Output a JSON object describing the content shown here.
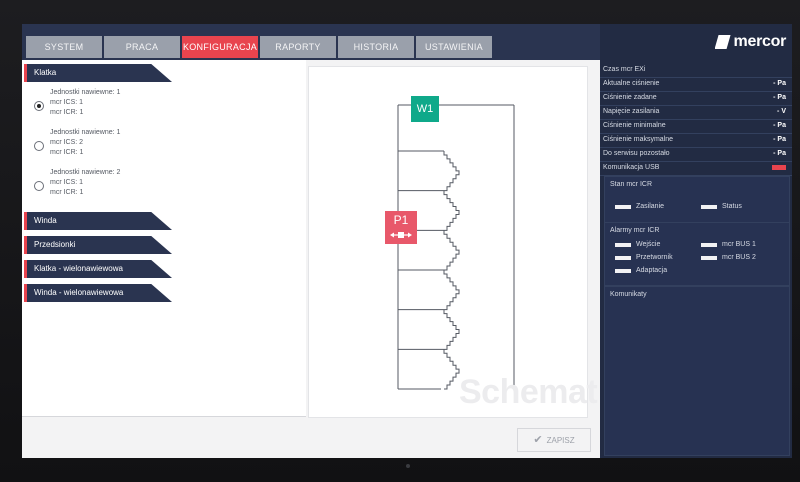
{
  "tabs": [
    {
      "label": "SYSTEM",
      "active": false
    },
    {
      "label": "PRACA",
      "active": false
    },
    {
      "label": "KONFIGURACJA",
      "active": true
    },
    {
      "label": "RAPORTY",
      "active": false
    },
    {
      "label": "HISTORIA",
      "active": false
    },
    {
      "label": "USTAWIENIA",
      "active": false
    }
  ],
  "sections": {
    "klatka": {
      "label": "Klatka",
      "options": [
        {
          "line1": "Jednostki nawiewne: 1",
          "line2": "mcr ICS: 1",
          "line3": "mcr ICR: 1",
          "selected": true
        },
        {
          "line1": "Jednostki nawiewne: 1",
          "line2": "mcr ICS: 2",
          "line3": "mcr ICR: 1",
          "selected": false
        },
        {
          "line1": "Jednostki nawiewne: 2",
          "line2": "mcr ICS: 1",
          "line3": "mcr ICR: 1",
          "selected": false
        }
      ]
    },
    "winda": {
      "label": "Winda"
    },
    "przedsionki": {
      "label": "Przedsionki"
    },
    "klatka_wielo": {
      "label": "Klatka - wielonawiewowa"
    },
    "winda_wielo": {
      "label": "Winda - wielonawiewowa"
    }
  },
  "schema": {
    "w1_label": "W1",
    "p1_label": "P1",
    "watermark": "Schemat",
    "floors": 6
  },
  "save_button": {
    "label": "ZAPISZ"
  },
  "logo": {
    "name": "mercor"
  },
  "status": {
    "rows": [
      {
        "label": "Czas mcr EXi",
        "value": ""
      },
      {
        "label": "Aktualne ciśnienie",
        "value": "- Pa"
      },
      {
        "label": "Ciśnienie zadane",
        "value": "- Pa"
      },
      {
        "label": "Napięcie zasilania",
        "value": "- V"
      },
      {
        "label": "Ciśnienie minimalne",
        "value": "- Pa"
      },
      {
        "label": "Ciśnienie maksymalne",
        "value": "- Pa"
      },
      {
        "label": "Do serwisu pozostało",
        "value": "- Pa"
      }
    ],
    "usb_label": "Komunikacja USB",
    "usb_color": "#e8444e"
  },
  "icr_state": {
    "title": "Stan mcr ICR",
    "items": [
      "Zasilanie",
      "Status"
    ]
  },
  "icr_alarms": {
    "title": "Alarmy mcr ICR",
    "items": [
      "Wejście",
      "mcr BUS 1",
      "Przetwornik",
      "mcr BUS 2",
      "Adaptacja"
    ]
  },
  "messages": {
    "title": "Komunikaty"
  },
  "colors": {
    "accent": "#e8444e",
    "navy": "#2a3450",
    "panel": "#222b43",
    "w1": "#0fa98a",
    "p1": "#e8586a"
  }
}
